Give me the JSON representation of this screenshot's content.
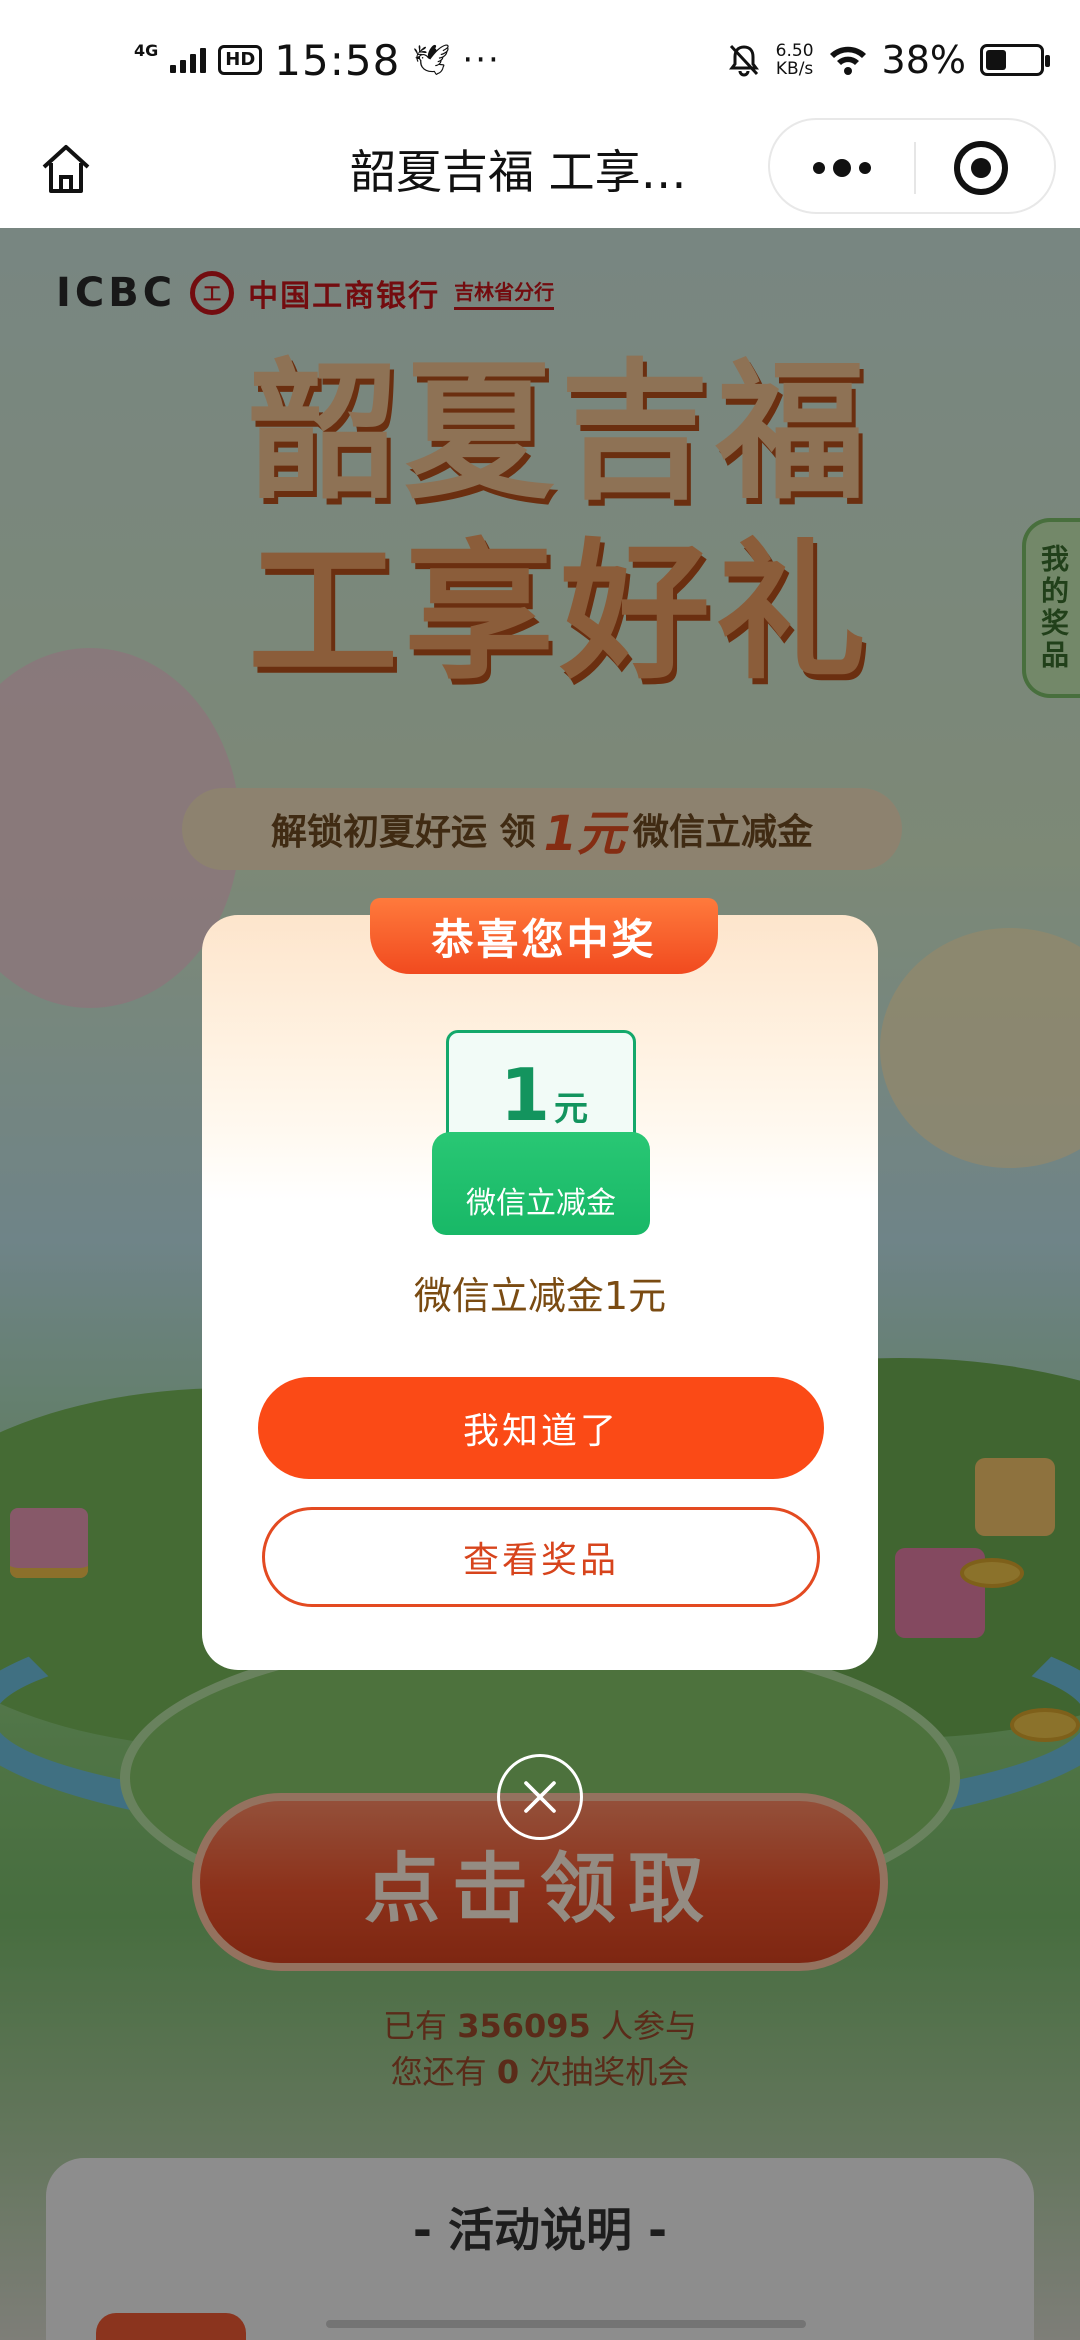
{
  "status_bar": {
    "network": "4G",
    "hd": "HD",
    "time": "15:58",
    "more": "···",
    "speed_value": "6.50",
    "speed_unit": "KB/s",
    "battery_percent": "38%",
    "battery_level": 0.38
  },
  "title_bar": {
    "title": "韶夏吉福 工享…",
    "icons": [
      "home-icon",
      "more-dots-icon",
      "target-close-icon"
    ]
  },
  "poster": {
    "bank_brand": "ICBC",
    "bank_name": "中国工商银行",
    "bank_branch": "吉林省分行",
    "headline_line1": "韶夏吉福",
    "headline_line2": "工享好礼",
    "subtitle_prefix": "解锁初夏好运  领",
    "subtitle_amount": "1元",
    "subtitle_suffix": "微信立减金",
    "my_prize_tab": "我的奖品",
    "claim_button": "点击领取",
    "participants_prefix": "已有",
    "participants_count": "356095",
    "participants_suffix": "人参与",
    "chances_prefix": "您还有",
    "chances_count": "0",
    "chances_suffix": "次抽奖机会",
    "rules_title": "- 活动说明 -"
  },
  "modal": {
    "ribbon": "恭喜您中奖",
    "coupon_amount": "1",
    "coupon_unit": "元",
    "coupon_label": "微信立减金",
    "prize_name": "微信立减金1元",
    "primary_button": "我知道了",
    "secondary_button": "查看奖品",
    "close_icon": "close-icon"
  },
  "colors": {
    "primary_orange": "#fb4a16",
    "coupon_green": "#18b867",
    "prize_text": "#7a4b12"
  }
}
